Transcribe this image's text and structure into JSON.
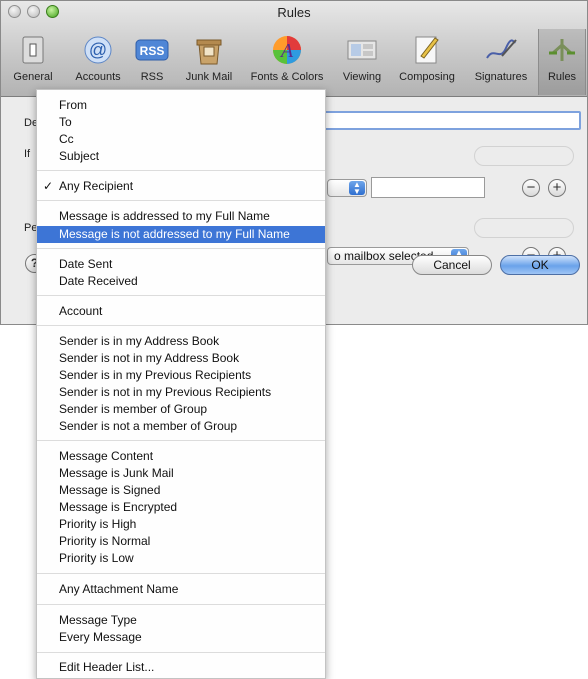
{
  "window": {
    "title": "Rules"
  },
  "toolbar": {
    "items": [
      {
        "label": "General",
        "icon": "general-icon"
      },
      {
        "label": "Accounts",
        "icon": "accounts-icon"
      },
      {
        "label": "RSS",
        "icon": "rss-icon"
      },
      {
        "label": "Junk Mail",
        "icon": "junk-mail-icon"
      },
      {
        "label": "Fonts & Colors",
        "icon": "fonts-colors-icon"
      },
      {
        "label": "Viewing",
        "icon": "viewing-icon"
      },
      {
        "label": "Composing",
        "icon": "composing-icon"
      },
      {
        "label": "Signatures",
        "icon": "signatures-icon"
      },
      {
        "label": "Rules",
        "icon": "rules-icon"
      }
    ],
    "rss_text": "RSS",
    "accounts_glyph": "@",
    "fonts_glyph": "A",
    "selected": "Rules"
  },
  "dialog": {
    "desc_label_partial": "De",
    "if_label": "If",
    "perform_label_partial": "Pe",
    "mailbox_popup": "o mailbox selected",
    "cancel": "Cancel",
    "ok": "OK",
    "help_glyph": "?",
    "minus_glyph": "−",
    "plus_glyph": "+"
  },
  "menu": {
    "checkmark": "✓",
    "items": [
      {
        "label": "From"
      },
      {
        "label": "To"
      },
      {
        "label": "Cc"
      },
      {
        "label": "Subject"
      },
      {
        "label": "Any Recipient",
        "checked": true
      },
      {
        "label": "Message is addressed to my Full Name"
      },
      {
        "label": "Message is not addressed to my Full Name",
        "highlighted": true
      },
      {
        "label": "Date Sent"
      },
      {
        "label": "Date Received"
      },
      {
        "label": "Account"
      },
      {
        "label": "Sender is in my Address Book"
      },
      {
        "label": "Sender is not in my Address Book"
      },
      {
        "label": "Sender is in my Previous Recipients"
      },
      {
        "label": "Sender is not in my Previous Recipients"
      },
      {
        "label": "Sender is member of Group"
      },
      {
        "label": "Sender is not a member of Group"
      },
      {
        "label": "Message Content"
      },
      {
        "label": "Message is Junk Mail"
      },
      {
        "label": "Message is Signed"
      },
      {
        "label": "Message is Encrypted"
      },
      {
        "label": "Priority is High"
      },
      {
        "label": "Priority is Normal"
      },
      {
        "label": "Priority is Low"
      },
      {
        "label": "Any Attachment Name"
      },
      {
        "label": "Message Type"
      },
      {
        "label": "Every Message"
      },
      {
        "label": "Edit Header List..."
      }
    ]
  },
  "colors": {
    "highlight": "#3d75d6",
    "default_button": "#6aa2ea",
    "zoom_button": "#41a21c"
  }
}
